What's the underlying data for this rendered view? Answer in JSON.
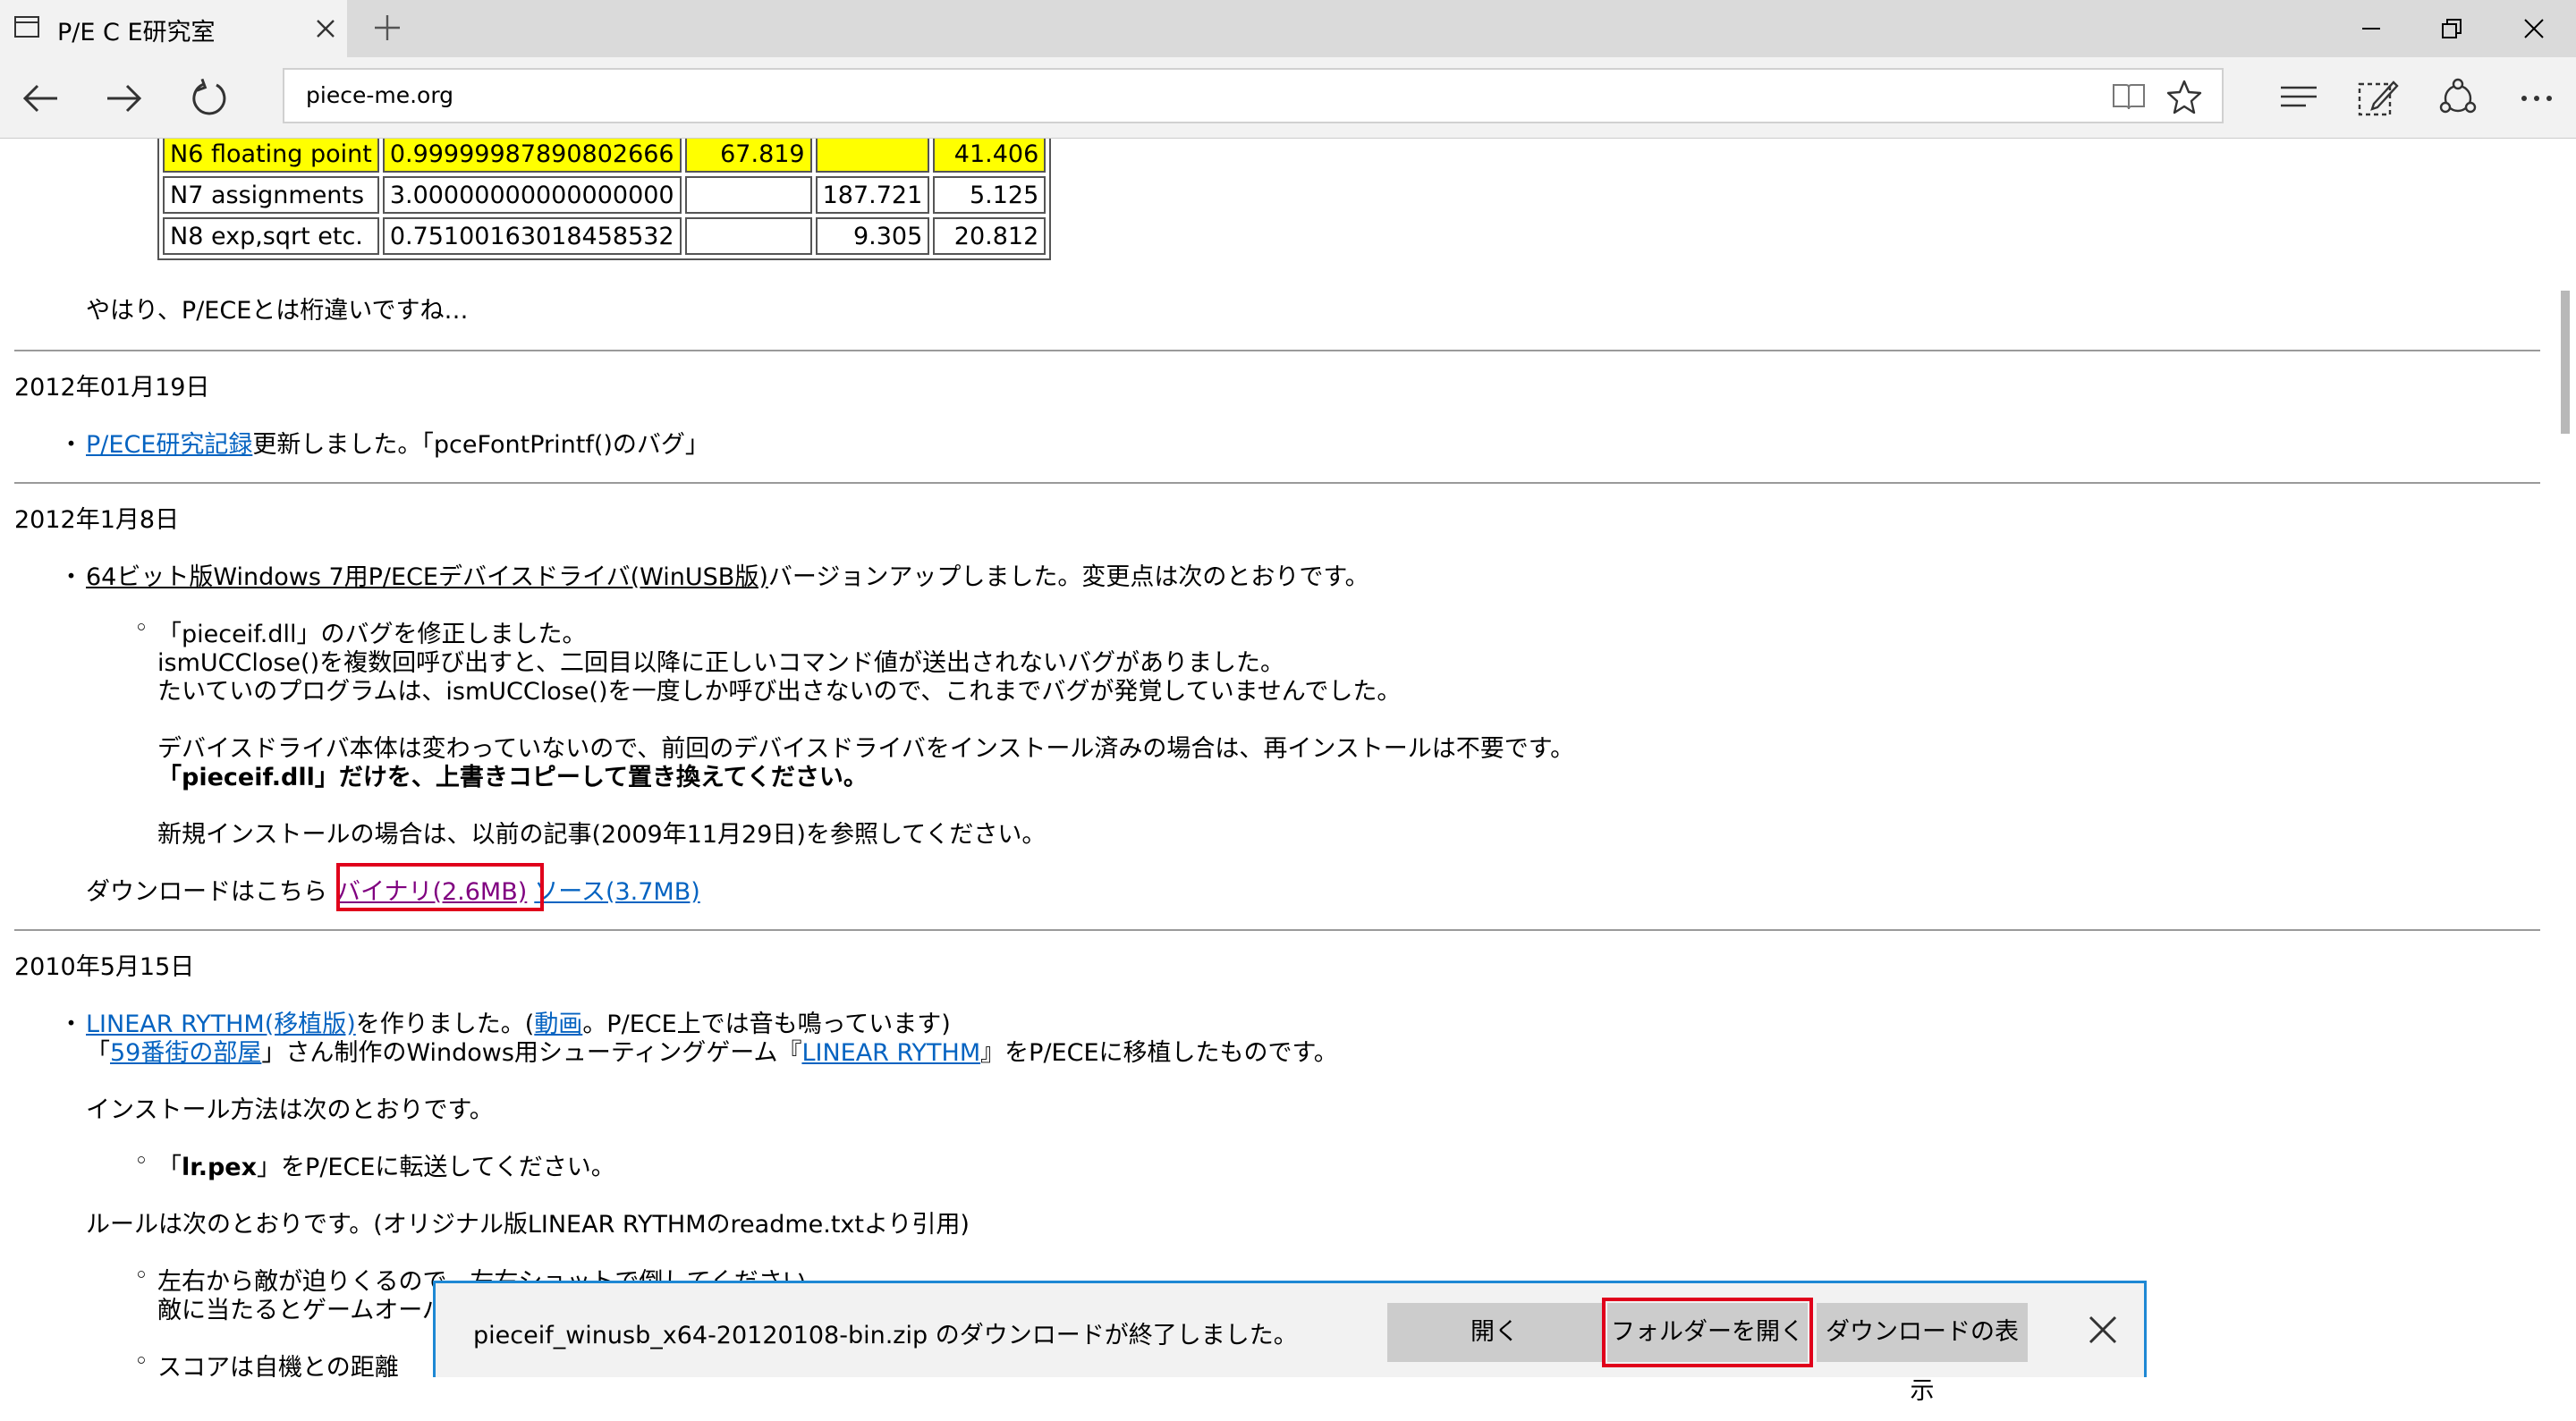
{
  "browser": {
    "tab_title": "P/E C E研究室",
    "url": "piece-me.org"
  },
  "benchmark_rows": [
    {
      "name": "N6 floating point",
      "value": "0.99999987890802666",
      "c3": "67.819",
      "c4": "",
      "c5": "41.406",
      "highlight": true
    },
    {
      "name": "N7 assignments",
      "value": "3.00000000000000000",
      "c3": "",
      "c4": "187.721",
      "c5": "5.125",
      "highlight": false
    },
    {
      "name": "N8 exp,sqrt etc.",
      "value": "0.75100163018458532",
      "c3": "",
      "c4": "9.305",
      "c5": "20.812",
      "highlight": false
    }
  ],
  "note_after_table": "やはり、P/ECEとは桁違いですね…",
  "entry_2012_01_19": {
    "date": "2012年01月19日",
    "bullet": "・",
    "link": "P/ECE研究記録",
    "text": "更新しました。「pceFontPrintf()のバグ」"
  },
  "entry_2012_01_08": {
    "date": "2012年1月8日",
    "bullet": "・",
    "title_link": "64ビット版Windows 7用P/ECEデバイスドライバ(WinUSB版)",
    "title_rest": "バージョンアップしました。変更点は次のとおりです。",
    "sub_bullet": "◦",
    "line1": "「pieceif.dll」のバグを修正しました。",
    "line2": "ismUCClose()を複数回呼び出すと、二回目以降に正しいコマンド値が送出されないバグがありました。",
    "line3": "たいていのプログラムは、ismUCClose()を一度しか呼び出さないので、これまでバグが発覚していませんでした。",
    "line4": "デバイスドライバ本体は変わっていないので、前回のデバイスドライバをインストール済みの場合は、再インストールは不要です。",
    "line5": "「pieceif.dll」だけを、上書きコピーして置き換えてください。",
    "line6": "新規インストールの場合は、以前の記事(2009年11月29日)を参照してください。",
    "download_prefix": "ダウンロードはこちら",
    "binary_link": "バイナリ(2.6MB)",
    "source_link": "ソース(3.7MB)"
  },
  "entry_2010_05_15": {
    "date": "2010年5月15日",
    "bullet": "・",
    "link1": "LINEAR RYTHM(移植版)",
    "text1a": "を作りました。(",
    "link2": "動画",
    "text1b": "。P/ECE上では音も鳴っています)",
    "line2_open": "「",
    "link3": "59番街の部屋",
    "line2_mid": "」さん制作のWindows用シューティングゲーム『",
    "link4": "LINEAR RYTHM",
    "line2_end": "』をP/ECEに移植したものです。",
    "install_heading": "インストール方法は次のとおりです。",
    "install_step_prefix": "「",
    "install_step_bold": "lr.pex",
    "install_step_rest": "」をP/ECEに転送してください。",
    "rules_heading": "ルールは次のとおりです。(オリジナル版LINEAR RYTHMのreadme.txtより引用)",
    "rule1": "左右から敵が迫りくるので、左右ショットで倒してください。",
    "rule1b": "敵に当たるとゲームオーバー",
    "rule2": "スコアは自機との距離"
  },
  "download_bar": {
    "message": "pieceif_winusb_x64-20120108-bin.zip のダウンロードが終了しました。",
    "open_label": "開く",
    "open_folder_label": "フォルダーを開く",
    "view_downloads_label": "ダウンロードの表示"
  },
  "colors": {
    "highlight": "#ffff00",
    "link": "#0563c1",
    "visited_link": "#800080",
    "annotation_red": "#e0001b",
    "download_bar_border": "#1e88d4"
  }
}
